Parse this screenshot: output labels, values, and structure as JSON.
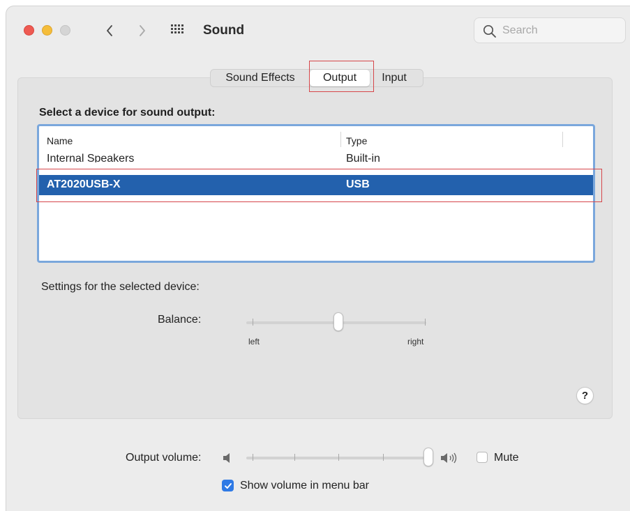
{
  "window": {
    "title": "Sound"
  },
  "search": {
    "placeholder": "Search",
    "value": ""
  },
  "tabs": [
    {
      "label": "Sound Effects",
      "selected": false
    },
    {
      "label": "Output",
      "selected": true
    },
    {
      "label": "Input",
      "selected": false
    }
  ],
  "device_list": {
    "heading": "Select a device for sound output:",
    "columns": {
      "name": "Name",
      "type": "Type"
    },
    "rows": [
      {
        "name": "Internal Speakers",
        "type": "Built-in",
        "selected": false
      },
      {
        "name": "AT2020USB-X",
        "type": "USB",
        "selected": true
      }
    ]
  },
  "settings": {
    "label": "Settings for the selected device:",
    "balance": {
      "label": "Balance:",
      "left_label": "left",
      "right_label": "right",
      "value": 0.5
    }
  },
  "help": {
    "label": "?"
  },
  "output_volume": {
    "label": "Output volume:",
    "value": 1.0,
    "mute_label": "Mute",
    "muted": false
  },
  "menu_bar": {
    "label": "Show volume in menu bar",
    "checked": true
  },
  "colors": {
    "selection": "#2361ad",
    "list_focus_ring": "#7aa7dc",
    "checkbox_accent": "#2f7ae5",
    "annotation_box": "#d6464a",
    "traffic_close": "#ee5a52",
    "traffic_minimize": "#f5bd3a",
    "traffic_zoom_inactive": "#d5d5d5"
  },
  "icons": {
    "back": "chevron-left-icon",
    "forward": "chevron-right-icon",
    "show_all": "grid-icon",
    "search": "magnifier-icon",
    "volume_low": "speaker-low-icon",
    "volume_high": "speaker-high-icon",
    "checkmark": "checkmark-icon"
  }
}
